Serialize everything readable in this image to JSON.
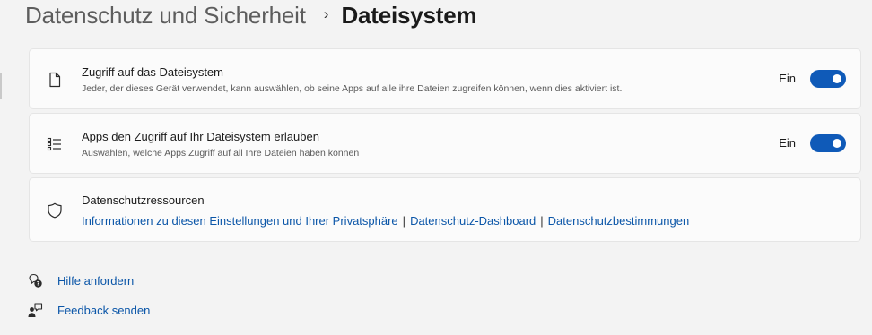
{
  "breadcrumb": {
    "parent": "Datenschutz und Sicherheit",
    "separator": "›",
    "current": "Dateisystem"
  },
  "settings": [
    {
      "icon": "document-icon",
      "title": "Zugriff auf das Dateisystem",
      "description": "Jeder, der dieses Gerät verwendet, kann auswählen, ob seine Apps auf alle ihre Dateien zugreifen können, wenn dies aktiviert ist.",
      "toggle_label": "Ein",
      "toggle_on": true
    },
    {
      "icon": "list-icon",
      "title": "Apps den Zugriff auf Ihr Dateisystem erlauben",
      "description": "Auswählen, welche Apps Zugriff auf all Ihre Dateien haben können",
      "toggle_label": "Ein",
      "toggle_on": true
    }
  ],
  "resources": {
    "icon": "shield-icon",
    "title": "Datenschutzressourcen",
    "links": [
      "Informationen zu diesen Einstellungen und Ihrer Privatsphäre",
      "Datenschutz-Dashboard",
      "Datenschutzbestimmungen"
    ],
    "separator": "|"
  },
  "help": {
    "get_help": "Hilfe anfordern",
    "feedback": "Feedback senden"
  },
  "colors": {
    "accent": "#0f5ab8",
    "link": "#0b56a8",
    "background": "#f3f3f3",
    "card": "#fbfbfb"
  }
}
